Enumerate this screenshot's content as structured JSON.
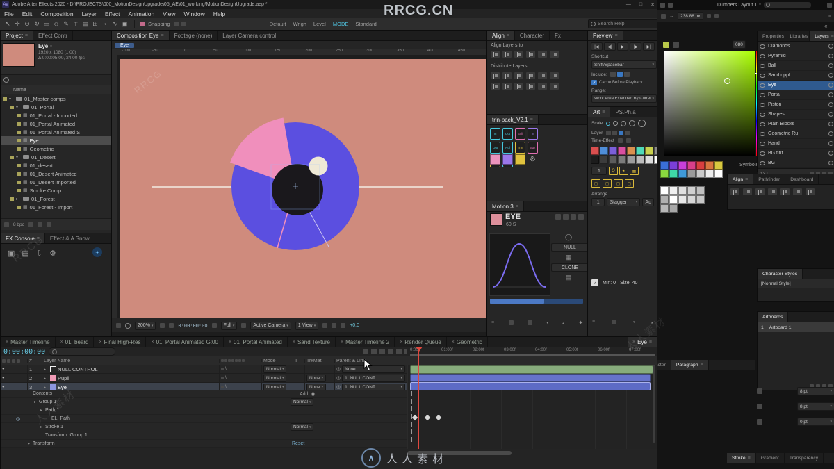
{
  "watermarks": {
    "top": "RRCG.CN",
    "bottom": "人人素材",
    "diag_rrcg": "RRCG",
    "diag_cn": "人人素材",
    "logo_glyph": "∧"
  },
  "ae": {
    "titlebar": {
      "title": "Adobe After Effects 2020 - D:\\PROJECTS\\000_MotionDesignUpgrade\\05_AE\\01_working\\MotionDesignUpgrade.aep *",
      "icon": "Ae",
      "min": "—",
      "max": "□",
      "close": "✕"
    },
    "menu": [
      "File",
      "Edit",
      "Composition",
      "Layer",
      "Effect",
      "Animation",
      "View",
      "Window",
      "Help"
    ],
    "toolbar": {
      "tools": [
        {
          "name": "selection-tool-icon",
          "glyph": "↖"
        },
        {
          "name": "hand-tool-icon",
          "glyph": "✛"
        },
        {
          "name": "zoom-tool-icon",
          "glyph": "⊙"
        },
        {
          "name": "orbit-tool-icon",
          "glyph": "↻"
        },
        {
          "name": "pan-tool-icon",
          "glyph": "▭"
        },
        {
          "name": "rotate-tool-icon",
          "glyph": "◇"
        },
        {
          "name": "pen-tool-icon",
          "glyph": "✎"
        },
        {
          "name": "type-tool-icon",
          "glyph": "T"
        },
        {
          "name": "brush-tool-icon",
          "glyph": "▤"
        },
        {
          "name": "clone-tool-icon",
          "glyph": "⊞"
        },
        {
          "name": "eraser-tool-icon",
          "glyph": "◔"
        },
        {
          "name": "puppet-tool-icon",
          "glyph": "∿"
        },
        {
          "name": "shape-tool-icon",
          "glyph": "▣"
        }
      ],
      "snapping": "Snapping",
      "workspaces": [
        "Default",
        "Wrigh",
        "Level",
        "MODE",
        "Standard"
      ],
      "active_workspace": "MODE",
      "search_help": "Search Help"
    },
    "project": {
      "tabs": {
        "items": [
          "Project",
          "Effect Contr"
        ],
        "active": 0
      },
      "item": {
        "name": "Eye",
        "line1": "1920 x 1080 (1.00)",
        "line2": "Δ 0:00:05:00, 24.00 fps"
      },
      "name_header": "Name",
      "tree_chip_color": "#a9a45a",
      "tree": [
        {
          "label": "01_Master comps",
          "icon": "folder",
          "level": 0,
          "open": true
        },
        {
          "label": "01_Portal",
          "icon": "folder",
          "level": 1,
          "open": true
        },
        {
          "label": "01_Portal - Imported",
          "icon": "comp",
          "level": 2
        },
        {
          "label": "01_Portal Animated",
          "icon": "comp",
          "level": 2
        },
        {
          "label": "01_Portal Animated S",
          "icon": "comp",
          "level": 2
        },
        {
          "label": "Eye",
          "icon": "comp",
          "level": 2,
          "selected": true
        },
        {
          "label": "Geometric",
          "icon": "comp",
          "level": 2
        },
        {
          "label": "01_Desert",
          "icon": "folder",
          "level": 1,
          "open": true
        },
        {
          "label": "01_desert",
          "icon": "comp",
          "level": 2
        },
        {
          "label": "01_Desert Animated",
          "icon": "comp",
          "level": 2
        },
        {
          "label": "01_Desert Imported",
          "icon": "comp",
          "level": 2
        },
        {
          "label": "Smoke Comp",
          "icon": "comp",
          "level": 2
        },
        {
          "label": "01_Forest",
          "icon": "folder",
          "level": 1,
          "open": false
        },
        {
          "label": "01_Forest - Import",
          "icon": "comp",
          "level": 2
        }
      ],
      "footer_bpc": "8 bpc"
    },
    "fx_console": {
      "tabs": {
        "items": [
          "FX Console",
          "Effect & A Snow"
        ],
        "active": 0
      },
      "icons": [
        {
          "name": "camera-icon",
          "glyph": "▣"
        },
        {
          "name": "monitor-icon",
          "glyph": "▤"
        },
        {
          "name": "download-icon",
          "glyph": "⇩"
        },
        {
          "name": "settings-icon",
          "glyph": "⚙"
        }
      ],
      "logo_glyph": "✦"
    },
    "viewer": {
      "tabs": {
        "items": [
          "Composition Eye",
          "Footage (none)",
          "Layer Camera control"
        ],
        "active": 0
      },
      "crumb": "Eye",
      "ruler_labels": [
        "-100",
        "-50",
        "0",
        "50",
        "100",
        "150",
        "200",
        "250",
        "300",
        "350",
        "400",
        "450"
      ],
      "bottom": {
        "zoom": "200%",
        "timecode": "0:00:00:00",
        "resolution": "Full",
        "camera": "Active Camera",
        "view": "1 View",
        "exposure": "+0.0"
      }
    },
    "align_panel": {
      "tabs": {
        "items": [
          "Align",
          "Character",
          "Fx"
        ],
        "active": 0
      },
      "align_label": "Align Layers to",
      "align_icons": [
        "align-left-icon",
        "align-center-h-icon",
        "align-right-icon",
        "align-top-icon",
        "align-center-v-icon",
        "align-bottom-icon"
      ],
      "dist_label": "Distribute Layers",
      "dist_icons1": [
        "dist-top-icon",
        "dist-center-v-icon",
        "dist-bottom-icon",
        "dist-left-icon",
        "dist-center-h-icon",
        "dist-right-icon"
      ],
      "dist_icons2": [
        "dist-h-space-icon",
        "dist-v-space-icon",
        "match-width-icon",
        "match-height-icon",
        "fit-comp-icon",
        "center-comp-icon"
      ]
    },
    "trin_pack": {
      "title": "trin-pack_V2.1",
      "buttons": [
        {
          "label": "In",
          "color": "#45c8dd"
        },
        {
          "label": "Out",
          "color": "#45c8dd"
        },
        {
          "label": "Edi",
          "color": "#e06fb2"
        },
        {
          "label": "In",
          "color": "#9a77ea"
        },
        {
          "label": "Out",
          "color": "#45c8dd"
        },
        {
          "label": "Nul",
          "color": "#45c8dd"
        },
        {
          "label": "Trm",
          "color": "#e0c23e"
        },
        {
          "label": "Sqz",
          "color": "#e06fb2"
        },
        {
          "label": "Hld",
          "color": "#e0c23e"
        },
        {
          "label": "Add",
          "color": "#45c8dd"
        }
      ],
      "swatches": [
        "#ec93bd",
        "#9a77ea",
        "#e0c23e"
      ],
      "gear_glyph": "⚙"
    },
    "motion3": {
      "title": "Motion 3",
      "name": "EYE",
      "sub": "60 S",
      "swatch": "#dd8f9b",
      "side_buttons": [
        "NULL",
        "CLONE"
      ],
      "side_icons": [
        {
          "name": "anchor-icon",
          "glyph": "◯"
        },
        {
          "name": "grid-icon",
          "glyph": "▦"
        },
        {
          "name": "list-icon",
          "glyph": "▤"
        }
      ]
    },
    "preview": {
      "tab": "Preview",
      "transport": [
        {
          "name": "first-frame-icon",
          "glyph": "|◀"
        },
        {
          "name": "prev-frame-icon",
          "glyph": "◀|"
        },
        {
          "name": "play-icon",
          "glyph": "▶"
        },
        {
          "name": "next-frame-icon",
          "glyph": "|▶"
        },
        {
          "name": "last-frame-icon",
          "glyph": "▶|"
        }
      ],
      "shortcut_label": "Shortcut",
      "shortcut_value": "Shift/Spacebar",
      "include_label": "Include:",
      "cache_label": "Cache Before Playback",
      "range_label": "Range:",
      "range_value": "Work Area Extended By Curren"
    },
    "tool_panel": {
      "tabs": {
        "items": [
          "Art",
          "PS.Ph.a"
        ],
        "active": 0
      },
      "scale_label": "Scale",
      "layer_label": "Layer",
      "time_label": "Time-Effect",
      "swatches1": [
        "#d94f4f",
        "#4f8ed9",
        "#7b5fd9",
        "#d94fa0",
        "#d9904f",
        "#4fd9b8",
        "#c9d14f",
        "#8a8a8a"
      ],
      "swatches2": [
        "#1c1c1c",
        "#3c3c3c",
        "#5c5c5c",
        "#7c7c7c",
        "#9c9c9c",
        "#bcbcbc",
        "#dcdcdc",
        "#ffffff"
      ],
      "grid_value": "1",
      "grid_buttons": [
        "Q",
        "☀",
        "▦"
      ],
      "key_icons": [
        "corner-tl-icon",
        "corner-tr-icon",
        "corner-bl-icon",
        "corner-br-icon"
      ],
      "arrange_label": "Arrange",
      "arrange_value": "1",
      "arrange_mode": "Stagger",
      "arrange_extra": "Au",
      "help": "?",
      "min_label": "Min: 0",
      "size_label": "Size: 40"
    },
    "timeline": {
      "tabs": [
        {
          "label": "Master Timeline"
        },
        {
          "label": "01_beard"
        },
        {
          "label": "Final High-Res"
        },
        {
          "label": "01_Portal Animated G:00"
        },
        {
          "label": "01_Portal Animated"
        },
        {
          "label": "Sand Texture"
        },
        {
          "label": "Master Timeline 2"
        },
        {
          "label": "Render Queue"
        },
        {
          "label": "Geometric"
        },
        {
          "label": "Eye",
          "active": true
        }
      ],
      "timecode": "0:00:00:00",
      "ruler": [
        "0:00f",
        "01:00f",
        "02:00f",
        "03:00f",
        "04:00f",
        "05:00f",
        "06:00f",
        "07:00f"
      ],
      "header": {
        "num": "#",
        "name": "Layer Name",
        "mode": "Mode",
        "t": "T",
        "trkmat": "TrkMat",
        "parent": "Parent & Link"
      },
      "layers": [
        {
          "num": "1",
          "name": "NULL CONTROL",
          "chip": "#f2f2f2",
          "hollow": true,
          "mode": "Normal",
          "trkmat": "",
          "parent": "None",
          "bar_color": "#87ac7c",
          "selected": false
        },
        {
          "num": "2",
          "name": "Pupil",
          "chip": "#ef9ab5",
          "hollow": false,
          "mode": "Normal",
          "trkmat": "None",
          "parent": "1. NULL CONT",
          "bar_color": "#6673cb",
          "selected": false
        },
        {
          "num": "3",
          "name": "Eye",
          "chip": "#8d96e0",
          "hollow": false,
          "mode": "Normal",
          "trkmat": "None",
          "parent": "1. NULL CONT",
          "bar_color": "#5d6bc6",
          "selected": true
        }
      ],
      "props": [
        {
          "label": "Contents",
          "indent": 1,
          "right": "Add:"
        },
        {
          "label": "Group 1",
          "indent": 2,
          "mode": "Normal",
          "arrow": true
        },
        {
          "label": "Path 1",
          "indent": 3,
          "arrow": true
        },
        {
          "label": "EL: Path",
          "indent": 4,
          "keyframes": [
            3,
            21,
            37
          ]
        },
        {
          "label": "Stroke 1",
          "indent": 3,
          "mode": "Normal",
          "arrow": true
        },
        {
          "label": "Transform: Group 1",
          "indent": 3
        },
        {
          "label": "Transform",
          "indent": 1,
          "reset": "Reset",
          "arrow": true
        }
      ]
    }
  },
  "ai": {
    "appbar": {
      "layout": "Dumbers Layout 1"
    },
    "controlbar": {
      "x_value": "238.88 px"
    },
    "picker": {
      "h_value": "080"
    },
    "symbols_label": "Symbols",
    "swatches1": [
      "#3a6fd9",
      "#7b3fd9",
      "#c93fd9",
      "#d93f8a",
      "#d93f3f",
      "#d9763f",
      "#d9c93f"
    ],
    "swatches2": [
      "#8ad93f",
      "#3fd9a8",
      "#3f9ad9",
      "#9a9a9a",
      "#c9c9c9",
      "#ededed",
      "#ffffff"
    ],
    "white_grid": [
      "#ffffff",
      "#f0f0f0",
      "#e0e0e0",
      "#d0d0d0",
      "#c0c0c0",
      "#b0b0b0",
      "#ffffff",
      "#e8e8e8",
      "#d8d8d8",
      "#c8c8c8",
      "#b8b8b8",
      "#a8a8a8"
    ],
    "panel_tabs": {
      "items": [
        "Properties",
        "Libraries",
        "Layers"
      ],
      "active": 2
    },
    "layers": [
      {
        "label": "Diamonds"
      },
      {
        "label": "Pyramid"
      },
      {
        "label": "Ball"
      },
      {
        "label": "Sand rippl"
      },
      {
        "label": "Eye",
        "selected": true
      },
      {
        "label": "Portal"
      },
      {
        "label": "Piston"
      },
      {
        "label": "Shapes"
      },
      {
        "label": "Plain Blocks"
      },
      {
        "label": "Geometric Ru"
      },
      {
        "label": "Hand"
      },
      {
        "label": "BG tint"
      },
      {
        "label": "BG"
      }
    ],
    "layers_footer": "13 L",
    "align_tabs": {
      "items": [
        "Align",
        "Pathfinder",
        "Dashboard"
      ],
      "active": 0
    },
    "align_icons": [
      "ai-align-left-icon",
      "ai-align-center-h-icon",
      "ai-align-right-icon",
      "ai-align-top-icon",
      "ai-align-center-v-icon",
      "ai-align-bottom-icon",
      "ai-distribute-icon"
    ],
    "char_styles": {
      "tab": "Character Styles",
      "row": "[Normal Style]"
    },
    "artboards": {
      "tab": "Artboards",
      "num": "1",
      "name": "Artboard 1"
    },
    "charpara_tabs": {
      "items": [
        "Character",
        "Paragraph"
      ],
      "active": 1
    },
    "fields": [
      {
        "value": "8 pt"
      },
      {
        "value": "8 pt"
      },
      {
        "value": "0 pt"
      }
    ],
    "bottom_tabs": {
      "items": [
        "Stroke",
        "Gradient",
        "Transparency"
      ],
      "active": 0
    }
  }
}
